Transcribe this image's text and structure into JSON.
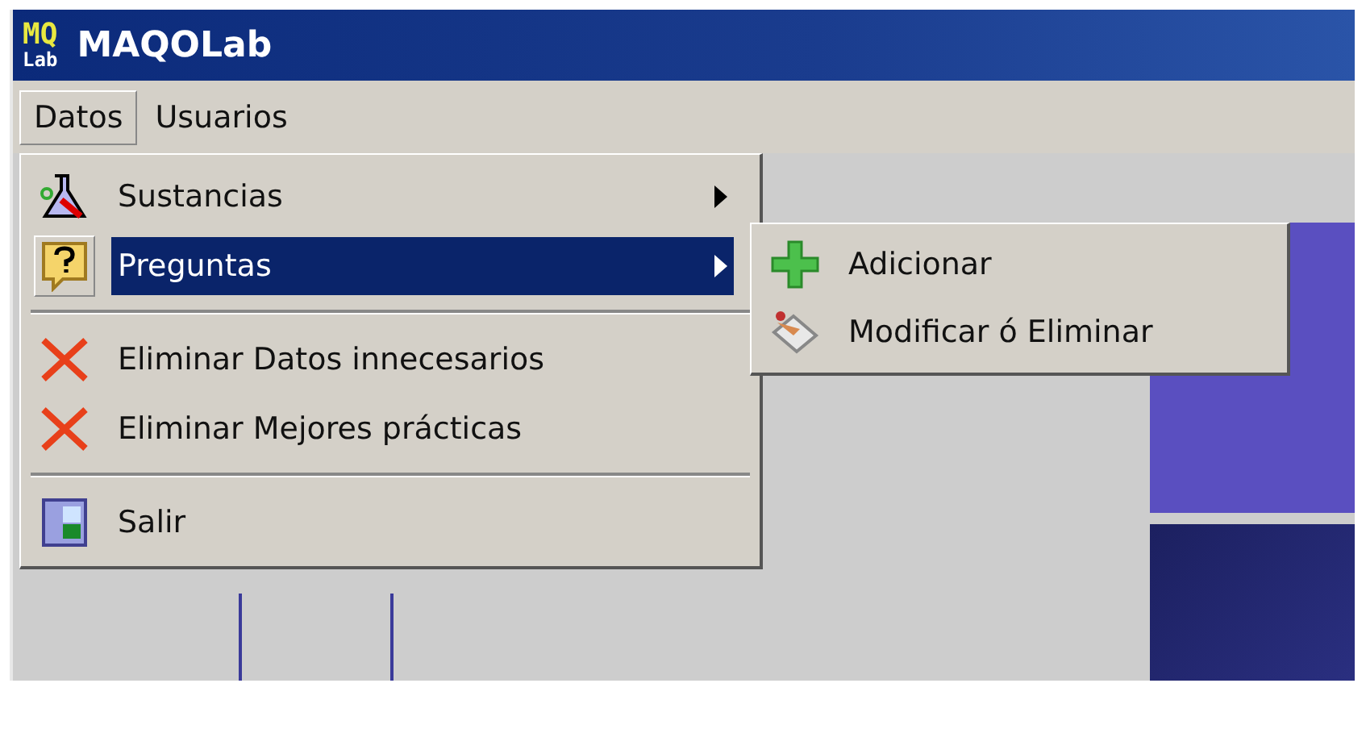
{
  "window": {
    "title": "MAQOLab",
    "logo_text": [
      "MQ",
      "Lab"
    ]
  },
  "menubar": [
    {
      "label": "Datos",
      "selected": true
    },
    {
      "label": "Usuarios",
      "selected": false
    }
  ],
  "menu": [
    {
      "kind": "submenu",
      "label": "Sustancias",
      "selected": false
    },
    {
      "kind": "submenu",
      "label": "Preguntas",
      "selected": true
    },
    {
      "kind": "separator"
    },
    {
      "kind": "command",
      "label": "Eliminar Datos innecesarios",
      "selected": false
    },
    {
      "kind": "command",
      "label": "Eliminar Mejores prácticas",
      "selected": false
    },
    {
      "kind": "separator"
    },
    {
      "kind": "command",
      "label": "Salir",
      "selected": false
    }
  ],
  "submenu": [
    {
      "label": "Adicionar",
      "selected": false
    },
    {
      "label": "Modificar ó Eliminar",
      "selected": false
    }
  ]
}
